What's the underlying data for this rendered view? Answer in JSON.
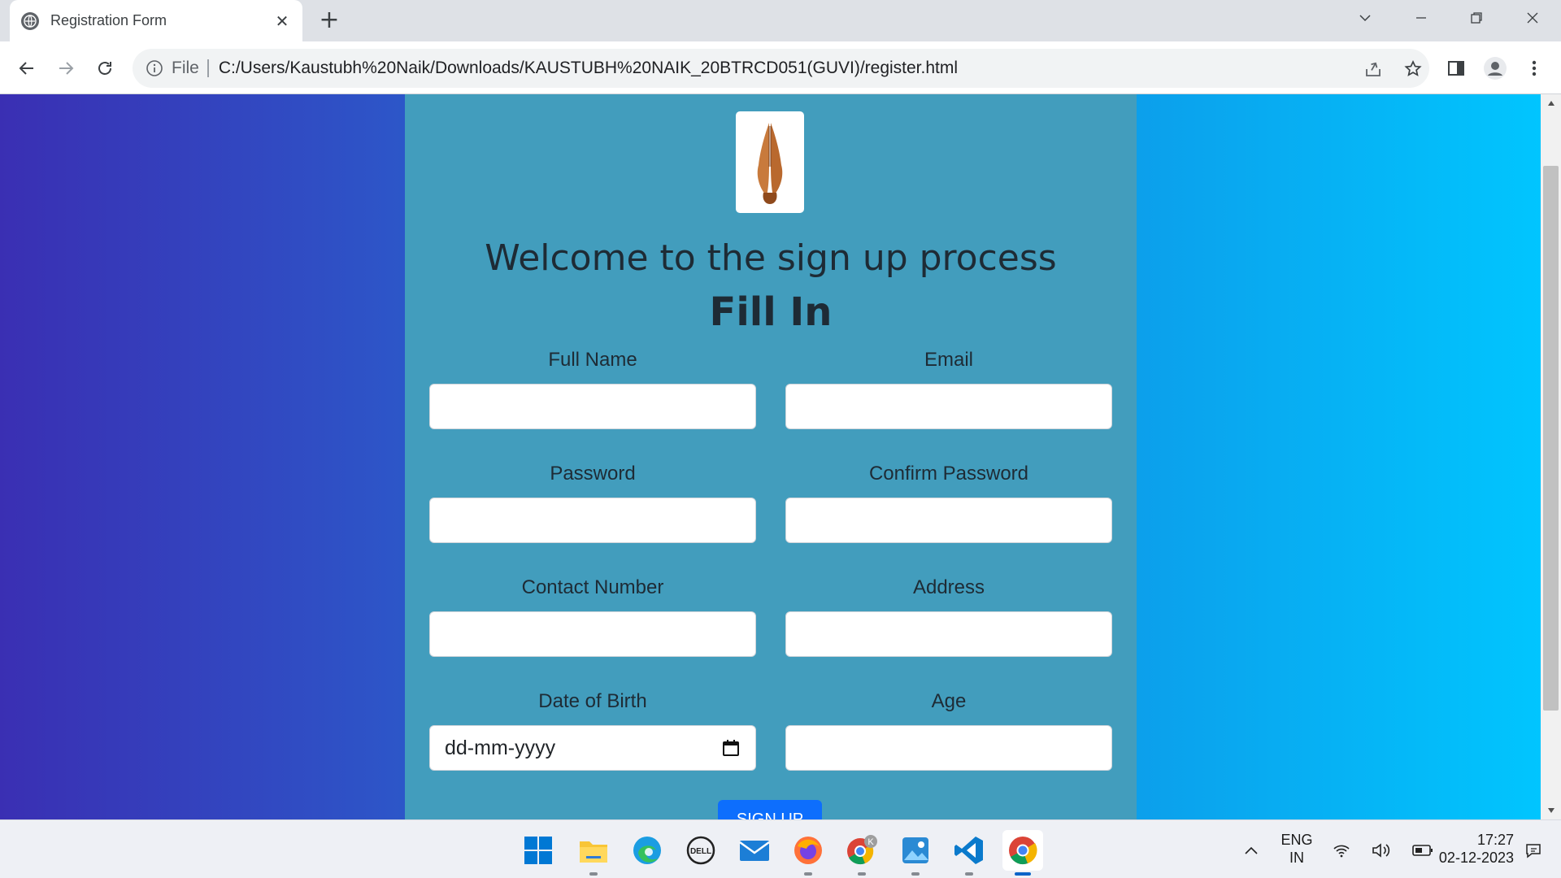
{
  "browser": {
    "tab_title": "Registration Form",
    "tab_close": "✕",
    "new_tab": "+",
    "url_scheme": "File",
    "url": "C:/Users/Kaustubh%20Naik/Downloads/KAUSTUBH%20NAIK_20BTRCD051(GUVI)/register.html"
  },
  "page": {
    "heading": "Welcome to the sign up process",
    "subheading": "Fill In",
    "fields": [
      {
        "label": "Full Name",
        "value": ""
      },
      {
        "label": "Email",
        "value": ""
      },
      {
        "label": "Password",
        "value": ""
      },
      {
        "label": "Confirm Password",
        "value": ""
      },
      {
        "label": "Contact Number",
        "value": ""
      },
      {
        "label": "Address",
        "value": ""
      },
      {
        "label": "Date of Birth",
        "placeholder": "dd-mm-yyyy"
      },
      {
        "label": "Age",
        "value": ""
      }
    ],
    "submit_label": "SIGN UP"
  },
  "taskbar": {
    "apps": [
      "windows-start",
      "file-explorer",
      "edge",
      "dell",
      "mail",
      "firefox",
      "chrome-profile",
      "photos",
      "vscode",
      "chrome"
    ],
    "chrome_profile_badge": "K",
    "lang_line1": "ENG",
    "lang_line2": "IN",
    "time": "17:27",
    "date": "02-12-2023"
  },
  "colors": {
    "card": "#429dbd",
    "gradient_start": "#3a2fb3",
    "gradient_end": "#00c7ff",
    "button": "#0d6efd"
  }
}
